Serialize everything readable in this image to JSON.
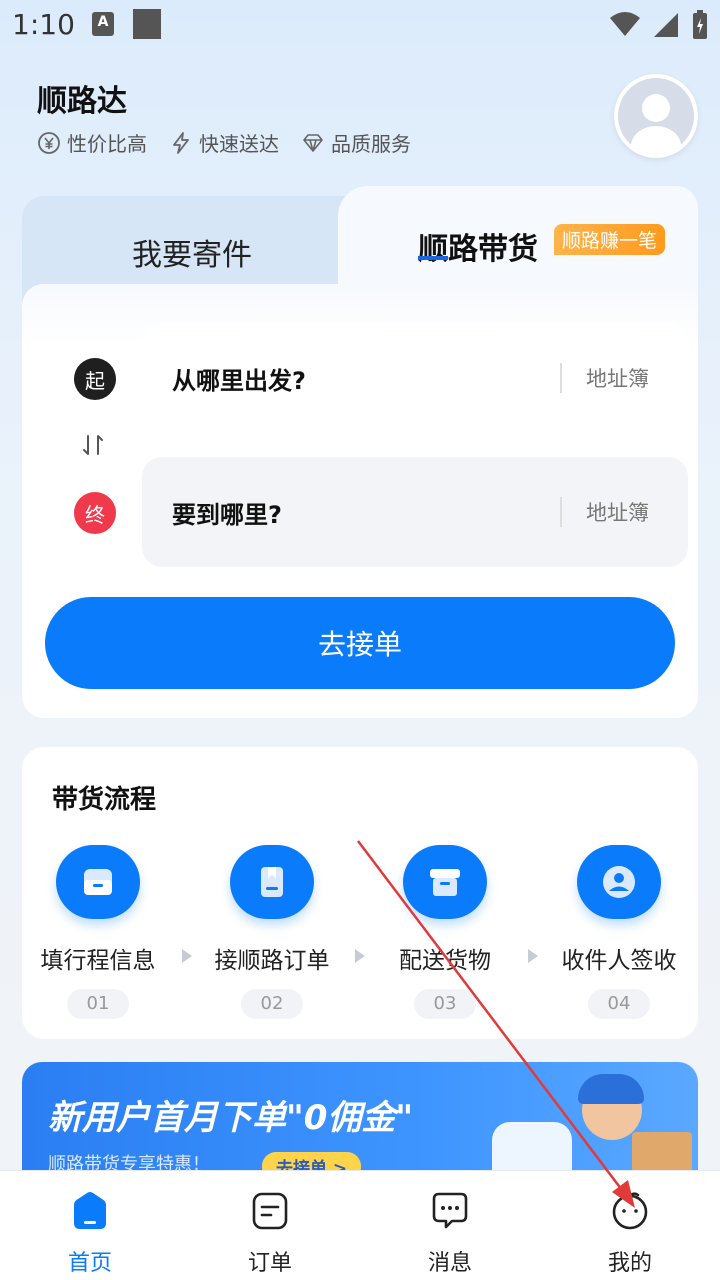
{
  "status_bar": {
    "time": "1:10",
    "notif_letter": "A"
  },
  "header": {
    "title": "顺路达",
    "features": [
      {
        "icon": "yen-icon",
        "label": "性价比高"
      },
      {
        "icon": "lightning-icon",
        "label": "快速送达"
      },
      {
        "icon": "diamond-icon",
        "label": "品质服务"
      }
    ]
  },
  "tabs": {
    "send": "我要寄件",
    "carry": "顺路带货",
    "carry_badge": "顺路赚一笔"
  },
  "route": {
    "start_marker": "起",
    "end_marker": "终",
    "from_placeholder": "从哪里出发?",
    "to_placeholder": "要到哪里?",
    "address_book": "地址簿",
    "go_button": "去接单"
  },
  "process": {
    "title": "带货流程",
    "steps": [
      {
        "label": "填行程信息",
        "num": "01"
      },
      {
        "label": "接顺路订单",
        "num": "02"
      },
      {
        "label": "配送货物",
        "num": "03"
      },
      {
        "label": "收件人签收",
        "num": "04"
      }
    ]
  },
  "banner": {
    "title": "新用户首月下单\"0佣金\"",
    "subtitle": "顺路带货专享特惠！",
    "button": "去接单 >"
  },
  "bottom_nav": [
    {
      "label": "首页",
      "icon": "home-icon",
      "active": true
    },
    {
      "label": "订单",
      "icon": "order-icon",
      "active": false
    },
    {
      "label": "消息",
      "icon": "message-icon",
      "active": false
    },
    {
      "label": "我的",
      "icon": "profile-icon",
      "active": false
    }
  ],
  "colors": {
    "primary": "#0a7bfa",
    "badge": "#ff9a1f",
    "end_marker": "#f0394b"
  }
}
